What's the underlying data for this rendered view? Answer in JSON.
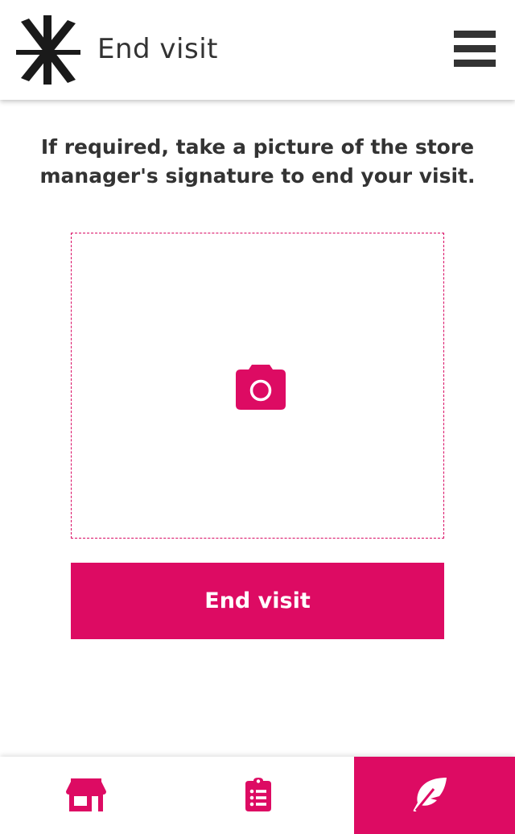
{
  "header": {
    "title": "End visit",
    "logo_icon": "asterisk-logo-icon",
    "menu_icon": "hamburger-menu-icon"
  },
  "main": {
    "instruction": "If required, take a picture of the store manager's signature to end your visit.",
    "photo_area_icon": "camera-icon",
    "end_button_label": "End visit"
  },
  "bottom_nav": {
    "items": [
      {
        "icon": "store-icon",
        "active": false
      },
      {
        "icon": "clipboard-list-icon",
        "active": false
      },
      {
        "icon": "feather-icon",
        "active": true
      }
    ]
  },
  "colors": {
    "accent": "#dd0b63",
    "text": "#333333",
    "background": "#ffffff"
  }
}
